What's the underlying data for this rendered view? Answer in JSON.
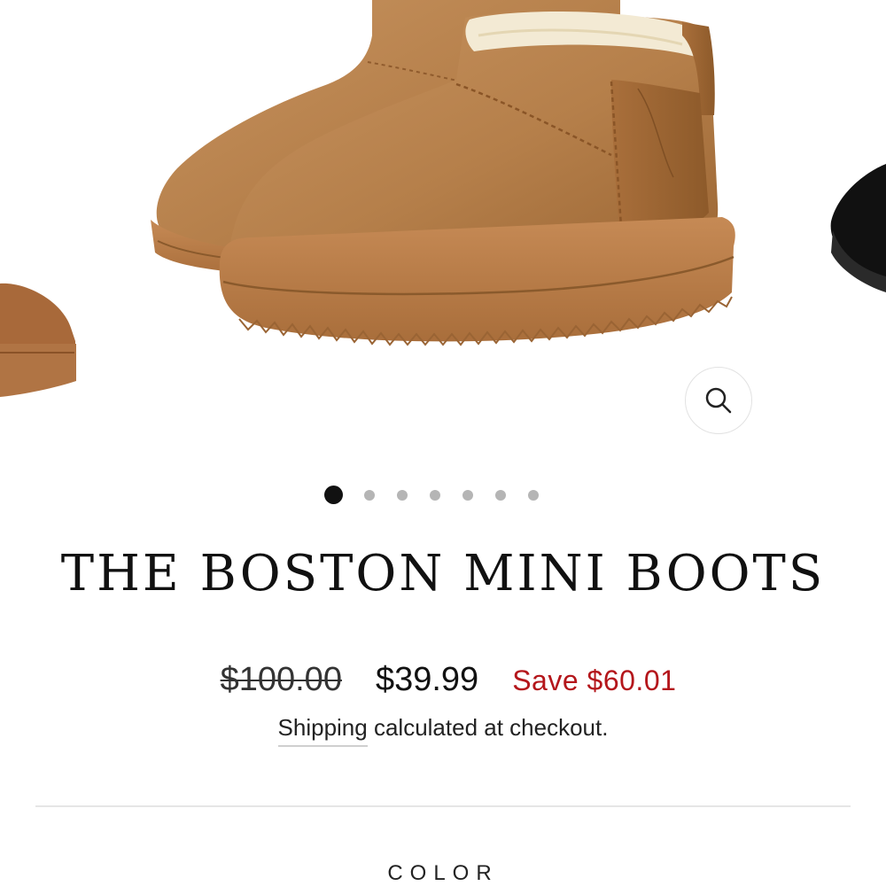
{
  "product": {
    "title": "THE BOSTON MINI BOOTS",
    "price_compare": "$100.00",
    "price_current": "$39.99",
    "price_save": "Save $60.01",
    "shipping_link": "Shipping",
    "shipping_rest": " calculated at checkout.",
    "option_label": "COLOR"
  },
  "gallery": {
    "slide_count": 7,
    "active_index": 0,
    "zoom_icon": "search-icon"
  },
  "colors": {
    "sale": "#b4161b",
    "boot_chestnut": "#b9834f",
    "boot_black": "#111111",
    "dot_active": "#111111",
    "dot_inactive": "#b5b5b5"
  }
}
